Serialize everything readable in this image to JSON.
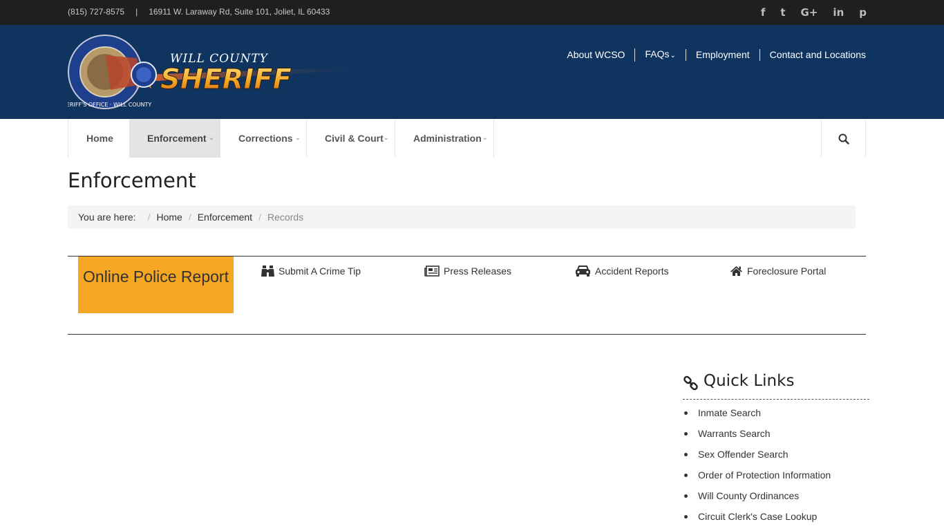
{
  "topbar": {
    "phone": "(815) 727-8575",
    "separator": "|",
    "address": "16911 W. Laraway Rd, Suite 101, Joliet, IL 60433",
    "social": [
      "f",
      "t",
      "G+",
      "in",
      "p"
    ]
  },
  "header": {
    "logo_top": "WILL COUNTY",
    "logo_main": "SHERIFF",
    "badge_ring": "SHERIFF'S OFFICE · WILL COUNTY",
    "nav": [
      {
        "label": "About WCSO"
      },
      {
        "label": "FAQs",
        "caret": "⌄"
      },
      {
        "label": "Employment"
      },
      {
        "label": "Contact and Locations"
      }
    ]
  },
  "mainnav": {
    "tabs": [
      {
        "label": "Home"
      },
      {
        "label": "Enforcement",
        "chev": "⌄"
      },
      {
        "label": "Corrections",
        "chev": "⌄"
      },
      {
        "label": "Civil & Court",
        "chev": "⌄"
      },
      {
        "label": "Administration",
        "chev": "⌄"
      }
    ]
  },
  "page": {
    "title": "Enforcement",
    "breadcrumb": {
      "prefix": "You are here:",
      "slash": "/",
      "items": [
        "Home",
        "Enforcement",
        "Records"
      ]
    }
  },
  "quick_actions": {
    "cta": "Online Police Report",
    "items": [
      {
        "label": "Submit A Crime Tip",
        "icon": "binoculars-icon"
      },
      {
        "label": "Press Releases",
        "icon": "newspaper-icon"
      },
      {
        "label": "Accident Reports",
        "icon": "car-icon"
      },
      {
        "label": "Foreclosure Portal",
        "icon": "home-icon"
      }
    ]
  },
  "quick_links": {
    "title": "Quick Links",
    "items": [
      "Inmate Search",
      "Warrants Search",
      "Sex Offender Search",
      "Order of Protection Information",
      "Will County Ordinances",
      "Circuit Clerk's Case Lookup"
    ]
  },
  "colors": {
    "topbar": "#1f1f1f",
    "header": "#0f3460",
    "cta": "#f5a623",
    "active_tab": "#e4e4e4"
  }
}
